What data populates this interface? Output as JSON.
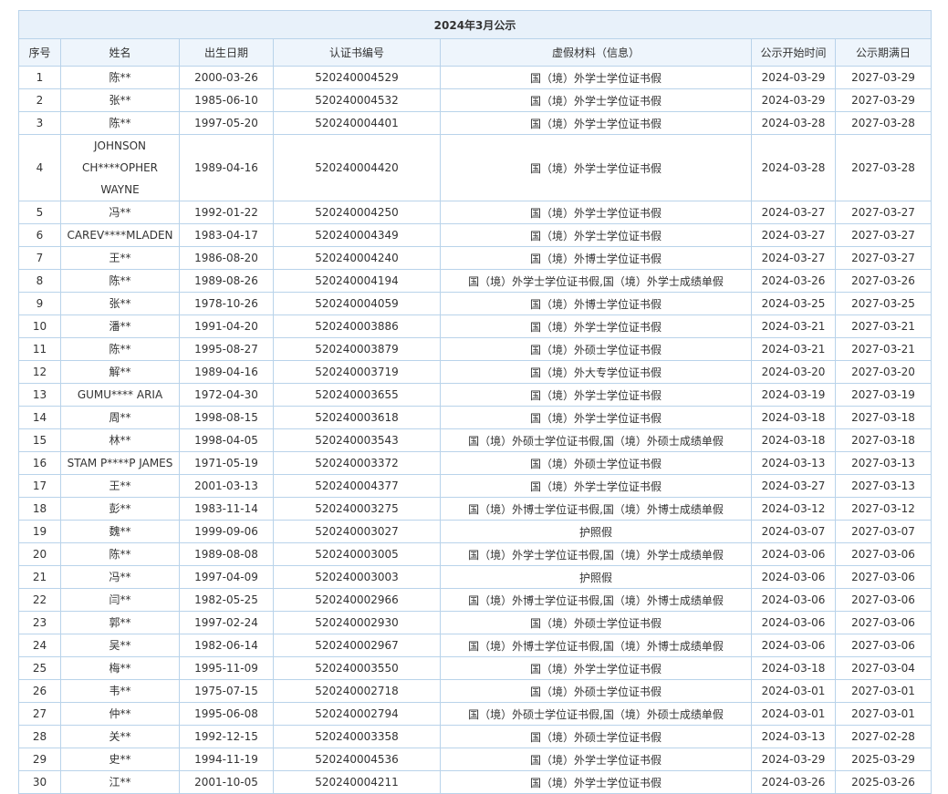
{
  "table_title": "2024年3月公示",
  "columns": [
    "序号",
    "姓名",
    "出生日期",
    "认证书编号",
    "虚假材料（信息）",
    "公示开始时间",
    "公示期满日"
  ],
  "rows": [
    [
      "1",
      "陈**",
      "2000-03-26",
      "520240004529",
      "国（境）外学士学位证书假",
      "2024-03-29",
      "2027-03-29"
    ],
    [
      "2",
      "张**",
      "1985-06-10",
      "520240004532",
      "国（境）外学士学位证书假",
      "2024-03-29",
      "2027-03-29"
    ],
    [
      "3",
      "陈**",
      "1997-05-20",
      "520240004401",
      "国（境）外学士学位证书假",
      "2024-03-28",
      "2027-03-28"
    ],
    [
      "4",
      "JOHNSON CH****OPHER WAYNE",
      "1989-04-16",
      "520240004420",
      "国（境）外学士学位证书假",
      "2024-03-28",
      "2027-03-28"
    ],
    [
      "5",
      "冯**",
      "1992-01-22",
      "520240004250",
      "国（境）外学士学位证书假",
      "2024-03-27",
      "2027-03-27"
    ],
    [
      "6",
      "CAREV****MLADEN",
      "1983-04-17",
      "520240004349",
      "国（境）外学士学位证书假",
      "2024-03-27",
      "2027-03-27"
    ],
    [
      "7",
      "王**",
      "1986-08-20",
      "520240004240",
      "国（境）外博士学位证书假",
      "2024-03-27",
      "2027-03-27"
    ],
    [
      "8",
      "陈**",
      "1989-08-26",
      "520240004194",
      "国（境）外学士学位证书假,国（境）外学士成绩单假",
      "2024-03-26",
      "2027-03-26"
    ],
    [
      "9",
      "张**",
      "1978-10-26",
      "520240004059",
      "国（境）外博士学位证书假",
      "2024-03-25",
      "2027-03-25"
    ],
    [
      "10",
      "潘**",
      "1991-04-20",
      "520240003886",
      "国（境）外学士学位证书假",
      "2024-03-21",
      "2027-03-21"
    ],
    [
      "11",
      "陈**",
      "1995-08-27",
      "520240003879",
      "国（境）外硕士学位证书假",
      "2024-03-21",
      "2027-03-21"
    ],
    [
      "12",
      "解**",
      "1989-04-16",
      "520240003719",
      "国（境）外大专学位证书假",
      "2024-03-20",
      "2027-03-20"
    ],
    [
      "13",
      "GUMU**** ARIA",
      "1972-04-30",
      "520240003655",
      "国（境）外学士学位证书假",
      "2024-03-19",
      "2027-03-19"
    ],
    [
      "14",
      "周**",
      "1998-08-15",
      "520240003618",
      "国（境）外学士学位证书假",
      "2024-03-18",
      "2027-03-18"
    ],
    [
      "15",
      "林**",
      "1998-04-05",
      "520240003543",
      "国（境）外硕士学位证书假,国（境）外硕士成绩单假",
      "2024-03-18",
      "2027-03-18"
    ],
    [
      "16",
      "STAM P****P JAMES",
      "1971-05-19",
      "520240003372",
      "国（境）外硕士学位证书假",
      "2024-03-13",
      "2027-03-13"
    ],
    [
      "17",
      "王**",
      "2001-03-13",
      "520240004377",
      "国（境）外学士学位证书假",
      "2024-03-27",
      "2027-03-13"
    ],
    [
      "18",
      "彭**",
      "1983-11-14",
      "520240003275",
      "国（境）外博士学位证书假,国（境）外博士成绩单假",
      "2024-03-12",
      "2027-03-12"
    ],
    [
      "19",
      "魏**",
      "1999-09-06",
      "520240003027",
      "护照假",
      "2024-03-07",
      "2027-03-07"
    ],
    [
      "20",
      "陈**",
      "1989-08-08",
      "520240003005",
      "国（境）外学士学位证书假,国（境）外学士成绩单假",
      "2024-03-06",
      "2027-03-06"
    ],
    [
      "21",
      "冯**",
      "1997-04-09",
      "520240003003",
      "护照假",
      "2024-03-06",
      "2027-03-06"
    ],
    [
      "22",
      "闫**",
      "1982-05-25",
      "520240002966",
      "国（境）外博士学位证书假,国（境）外博士成绩单假",
      "2024-03-06",
      "2027-03-06"
    ],
    [
      "23",
      "郭**",
      "1997-02-24",
      "520240002930",
      "国（境）外硕士学位证书假",
      "2024-03-06",
      "2027-03-06"
    ],
    [
      "24",
      "吴**",
      "1982-06-14",
      "520240002967",
      "国（境）外博士学位证书假,国（境）外博士成绩单假",
      "2024-03-06",
      "2027-03-06"
    ],
    [
      "25",
      "梅**",
      "1995-11-09",
      "520240003550",
      "国（境）外学士学位证书假",
      "2024-03-18",
      "2027-03-04"
    ],
    [
      "26",
      "韦**",
      "1975-07-15",
      "520240002718",
      "国（境）外硕士学位证书假",
      "2024-03-01",
      "2027-03-01"
    ],
    [
      "27",
      "仲**",
      "1995-06-08",
      "520240002794",
      "国（境）外硕士学位证书假,国（境）外硕士成绩单假",
      "2024-03-01",
      "2027-03-01"
    ],
    [
      "28",
      "关**",
      "1992-12-15",
      "520240003358",
      "国（境）外硕士学位证书假",
      "2024-03-13",
      "2027-02-28"
    ],
    [
      "29",
      "史**",
      "1994-11-19",
      "520240004536",
      "国（境）外学士学位证书假",
      "2024-03-29",
      "2025-03-29"
    ],
    [
      "30",
      "江**",
      "2001-10-05",
      "520240004211",
      "国（境）外学士学位证书假",
      "2024-03-26",
      "2025-03-26"
    ]
  ]
}
